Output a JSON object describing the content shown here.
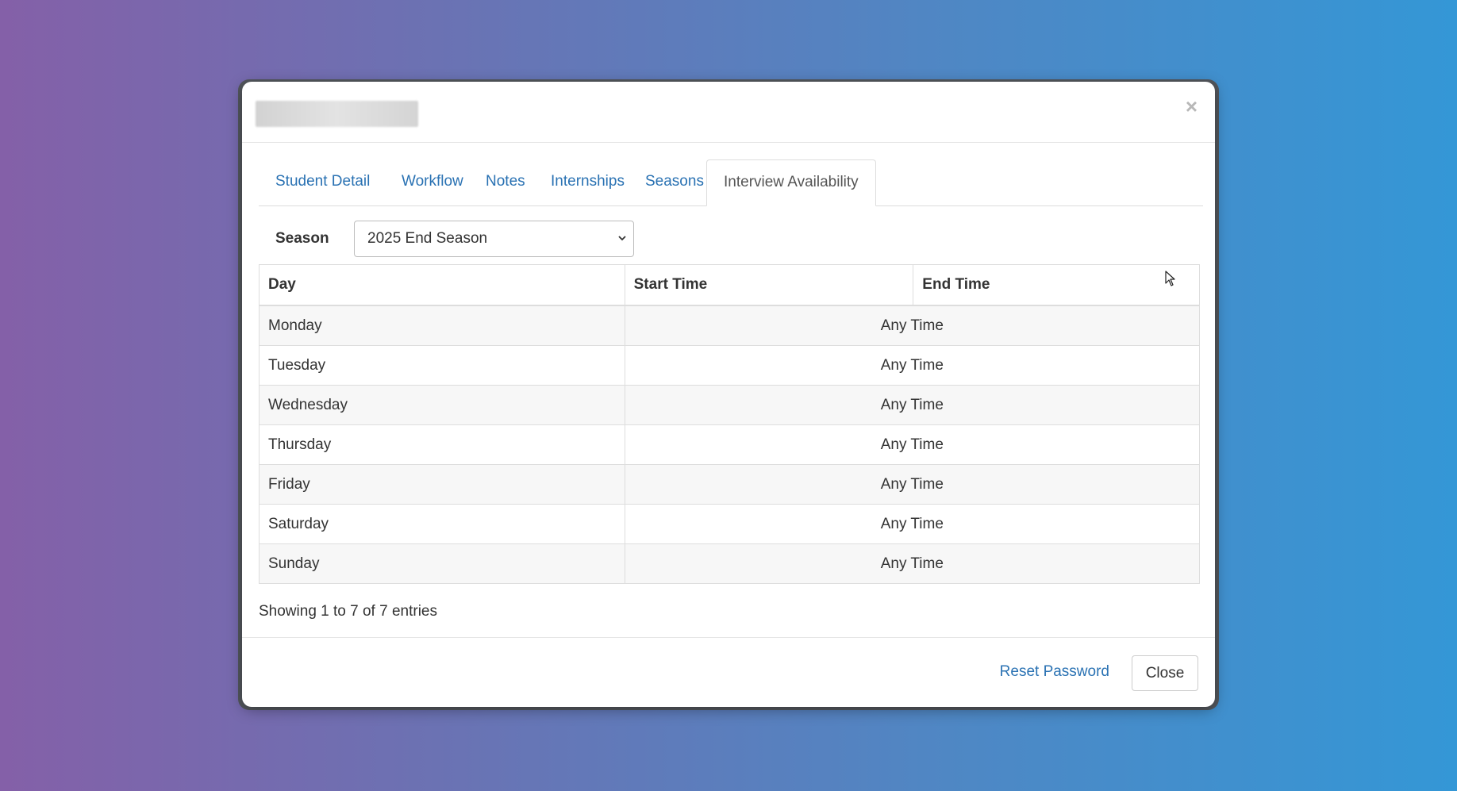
{
  "modal": {
    "close_glyph": "×"
  },
  "tabs": [
    {
      "label": "Student Detail"
    },
    {
      "label": "Workflow"
    },
    {
      "label": "Notes"
    },
    {
      "label": "Internships"
    },
    {
      "label": "Seasons"
    },
    {
      "label": "Interview Availability",
      "active": true
    }
  ],
  "season": {
    "label": "Season",
    "selected": "2025 End Season"
  },
  "table": {
    "headers": [
      "Day",
      "Start Time",
      "End Time"
    ],
    "rows": [
      {
        "day": "Monday",
        "time": "Any Time"
      },
      {
        "day": "Tuesday",
        "time": "Any Time"
      },
      {
        "day": "Wednesday",
        "time": "Any Time"
      },
      {
        "day": "Thursday",
        "time": "Any Time"
      },
      {
        "day": "Friday",
        "time": "Any Time"
      },
      {
        "day": "Saturday",
        "time": "Any Time"
      },
      {
        "day": "Sunday",
        "time": "Any Time"
      }
    ],
    "info": "Showing 1 to 7 of 7 entries"
  },
  "footer": {
    "reset_label": "Reset Password",
    "close_label": "Close"
  },
  "colors": {
    "link": "#2a72b3",
    "text": "#333333"
  }
}
